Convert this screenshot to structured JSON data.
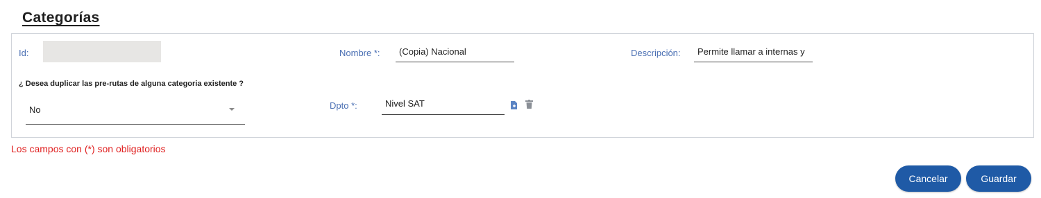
{
  "page": {
    "title": "Categorías"
  },
  "form": {
    "id_label": "Id:",
    "id_value": "",
    "nombre_label": "Nombre *:",
    "nombre_value": "(Copia) Nacional",
    "descripcion_label": "Descripción:",
    "descripcion_value": "Permite llamar a internas y",
    "duplicate_question": "¿ Desea duplicar las pre-rutas de alguna categoria existente ?",
    "duplicate_selected": "No",
    "dpto_label": "Dpto *:",
    "dpto_value": "Nivel SAT",
    "dpto_add_icon": "add-document-icon",
    "dpto_delete_icon": "trash-icon"
  },
  "notes": {
    "required": "Los campos con (*) son obligatorios"
  },
  "actions": {
    "cancel_label": "Cancelar",
    "save_label": "Guardar"
  },
  "colors": {
    "label": "#4a6fb3",
    "button": "#1f5aa6",
    "required_note": "#e02020",
    "readonly_bg": "#e7e6e4"
  }
}
